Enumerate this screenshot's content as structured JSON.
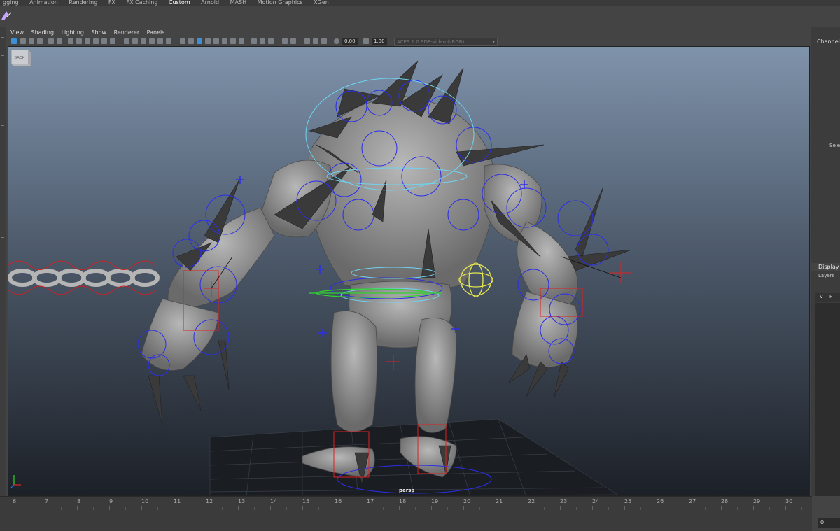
{
  "shelf": {
    "tabs": [
      "gging",
      "Animation",
      "Rendering",
      "FX",
      "FX Caching",
      "Custom",
      "Arnold",
      "MASH",
      "Motion Graphics",
      "XGen"
    ],
    "active_tab": "Custom"
  },
  "viewport_menu": [
    "View",
    "Shading",
    "Lighting",
    "Show",
    "Renderer",
    "Panels"
  ],
  "toolbar": {
    "exposure": "0.00",
    "gamma": "1.00",
    "color_space": "ACES 1.0 SDR-video (sRGB)"
  },
  "viewport": {
    "camera": "persp",
    "viewcube_face": "BACK",
    "background_top": "#7f93ab",
    "background_bottom": "#1c2027"
  },
  "right_panel": {
    "channels": "Channels",
    "selection": "Selec",
    "display_tab": "Display",
    "layers_tab": "Layers",
    "v": "V",
    "p": "P"
  },
  "timeline": {
    "ticks": [
      "6",
      "7",
      "8",
      "9",
      "10",
      "11",
      "12",
      "13",
      "14",
      "15",
      "16",
      "17",
      "18",
      "19",
      "20",
      "21",
      "22",
      "23",
      "24",
      "25",
      "26",
      "27",
      "28",
      "29",
      "30"
    ],
    "current_frame": "0"
  },
  "colors": {
    "rig_blue": "#2b2ee8",
    "rig_red": "#e02020",
    "rig_green": "#2ed62e",
    "rig_yellow": "#e8e850",
    "rig_cyan": "#6fd3f0"
  }
}
